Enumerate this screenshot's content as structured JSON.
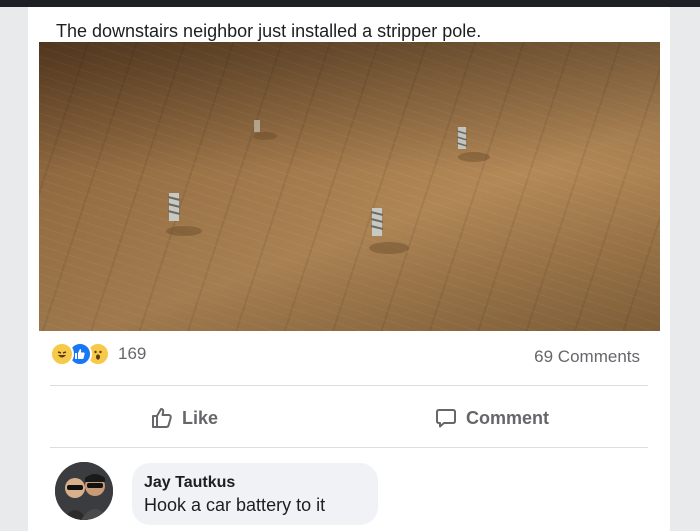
{
  "post": {
    "caption": "The downstairs neighbor just installed a stripper pole.",
    "reaction_count": "169",
    "comments_count": "69 Comments"
  },
  "reactions": [
    "haha-reaction-icon",
    "like-reaction-icon",
    "wow-reaction-icon"
  ],
  "actions": {
    "like_label": "Like",
    "comment_label": "Comment"
  },
  "comment": {
    "author": "Jay Tautkus",
    "text": "Hook a car battery to it"
  },
  "colors": {
    "like_blue": "#1877f2",
    "reaction_yellow": "#f7c948",
    "secondary_text": "#65676b",
    "bubble_bg": "#f0f2f5"
  }
}
